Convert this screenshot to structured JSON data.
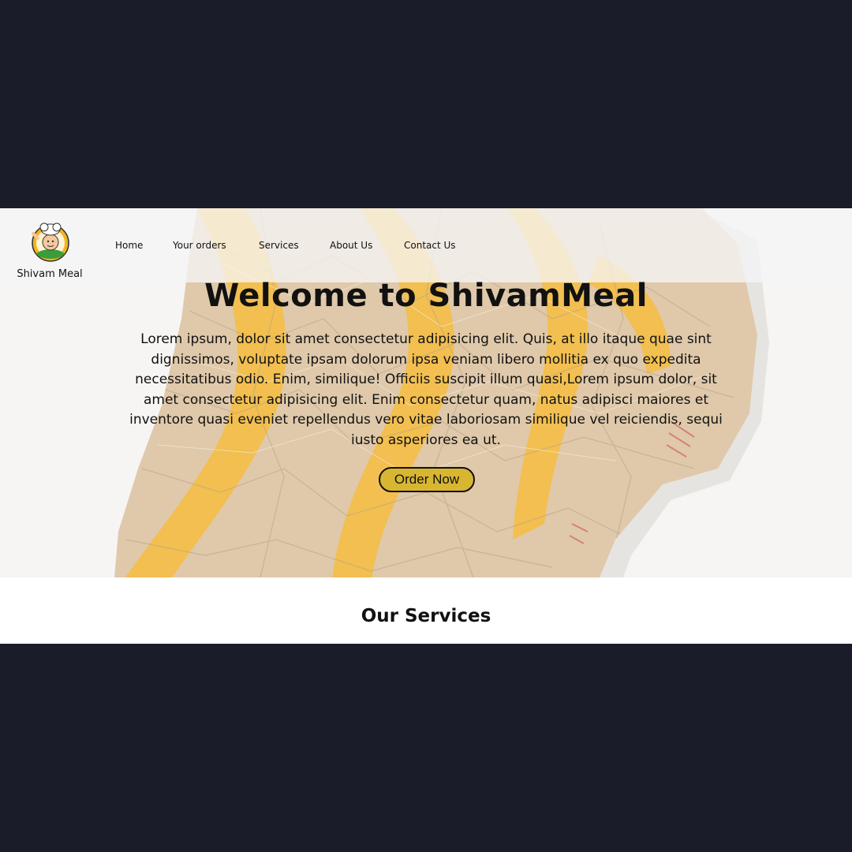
{
  "brand": {
    "name": "Shivam Meal",
    "logo_icon": "chef-mascot-icon"
  },
  "nav": {
    "items": [
      {
        "label": "Home"
      },
      {
        "label": "Your orders"
      },
      {
        "label": "Services"
      },
      {
        "label": "About Us"
      },
      {
        "label": "Contact Us"
      }
    ]
  },
  "hero": {
    "title": "Welcome to ShivamMeal",
    "body": "Lorem ipsum, dolor sit amet consectetur adipisicing elit. Quis, at illo itaque quae sint dignissimos, voluptate ipsam dolorum ipsa veniam libero mollitia ex quo expedita necessitatibus odio. Enim, similique! Officiis suscipit illum quasi,Lorem ipsum dolor, sit amet consectetur adipisicing elit. Enim consectetur quam, natus adipisci maiores et inventore quasi eveniet repellendus vero vitae laboriosam similique vel reiciendis, sequi iusto asperiores ea ut.",
    "cta_label": "Order Now",
    "background_image": "crumpled-paper-bag-image"
  },
  "services": {
    "title": "Our Services"
  },
  "colors": {
    "page_background": "#1a1c2a",
    "cta_background": "#d9b632",
    "bag_paper": "#d8bd98",
    "bag_stripe": "#f0b12a"
  }
}
